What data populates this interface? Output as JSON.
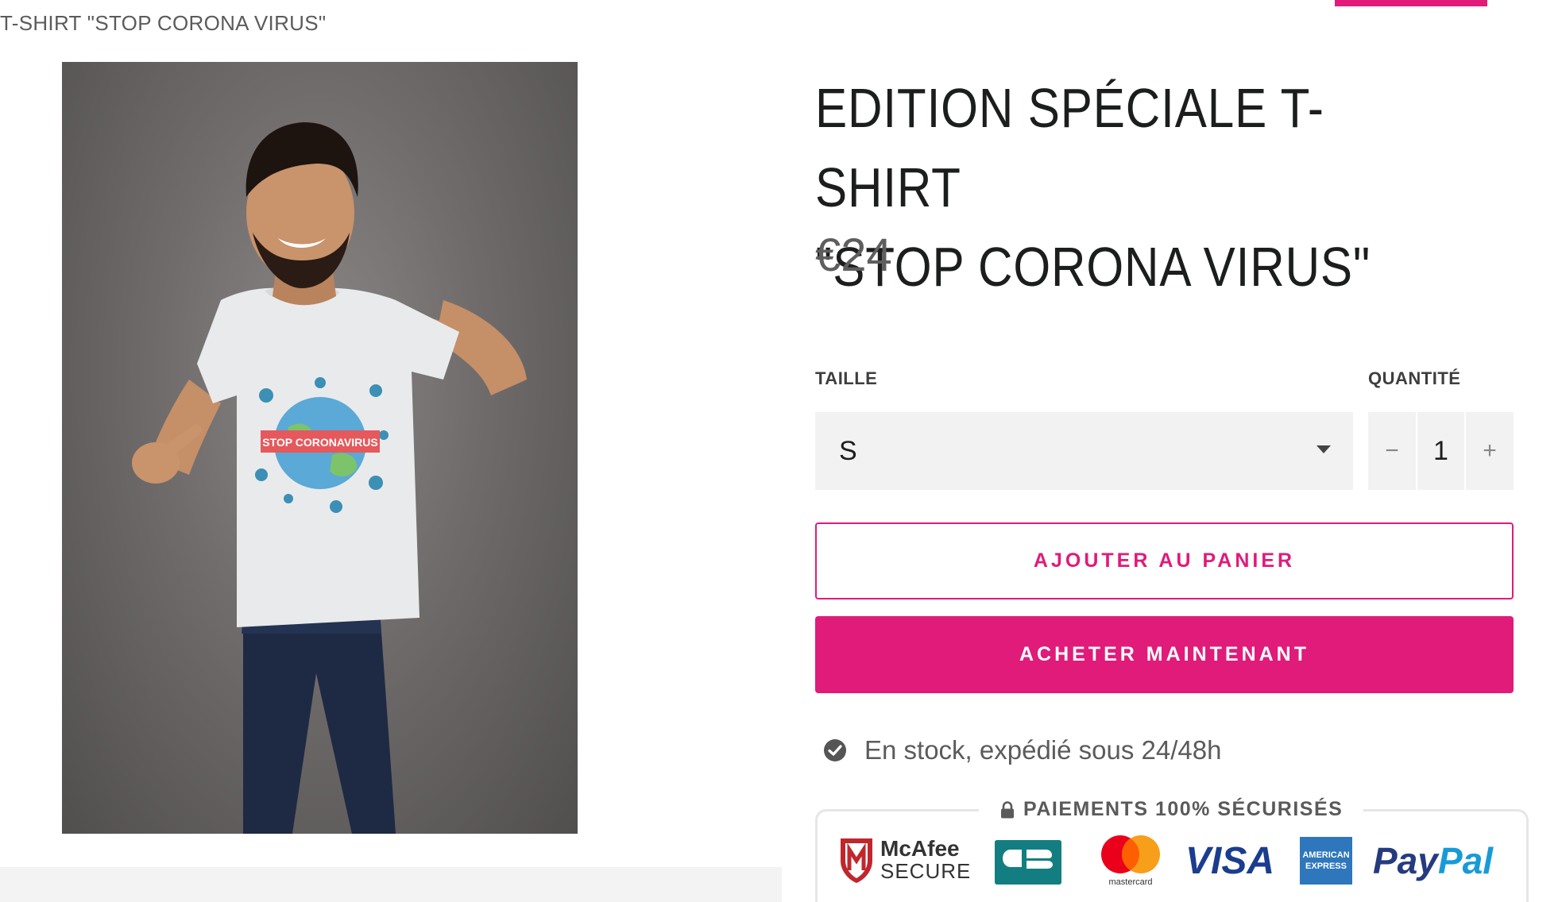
{
  "breadcrumb": "T-SHIRT \"STOP CORONA VIRUS\"",
  "product": {
    "title_line1": "EDITION SPÉCIALE T-SHIRT",
    "title_line2": "\"STOP CORONA VIRUS\"",
    "price": "€24",
    "image_shirt_text": "STOP CORONAVIRUS"
  },
  "options": {
    "size_label": "TAILLE",
    "size_value": "S",
    "quantity_label": "QUANTITÉ",
    "quantity_value": "1",
    "minus": "−",
    "plus": "+"
  },
  "actions": {
    "add_to_cart": "AJOUTER AU PANIER",
    "buy_now": "ACHETER MAINTENANT"
  },
  "stock": {
    "text": "En stock, expédié sous 24/48h",
    "icon": "check-circle-icon"
  },
  "payments": {
    "title": "PAIEMENTS 100% SÉCURISÉS",
    "logos": [
      "McAfee SECURE",
      "CB",
      "mastercard",
      "VISA",
      "AMERICAN EXPRESS",
      "PayPal"
    ],
    "mcafee_line1": "McAfee",
    "mcafee_line2": "SECURE",
    "mastercard_text": "mastercard",
    "visa_text": "VISA",
    "amex_line1": "AMERICAN",
    "amex_line2": "EXPRESS",
    "paypal_pay": "Pay",
    "paypal_pal": "Pal"
  },
  "colors": {
    "accent": "#e01b7a",
    "text": "#1c1d1d",
    "muted": "#5b5b5b",
    "field_bg": "#f2f2f2"
  }
}
